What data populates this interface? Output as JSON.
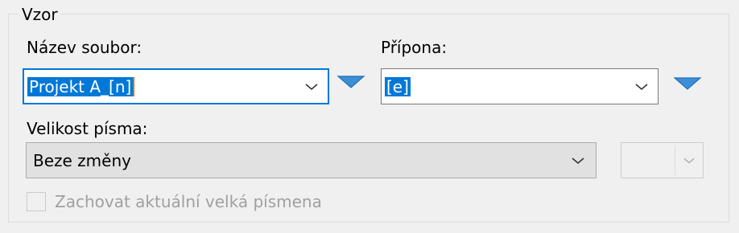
{
  "group": {
    "title": "Vzor"
  },
  "filename": {
    "label": "Název soubor:",
    "value": "Projekt A_[n]"
  },
  "extension": {
    "label": "Přípona:",
    "value": "[e]"
  },
  "font_size": {
    "label": "Velikost písma:",
    "value": "Beze změny",
    "secondary_value": ""
  },
  "keep_case": {
    "label": "Zachovat aktuální velká písmena",
    "checked": false
  },
  "icons": {
    "dropdown_chevron": "chevron-down-icon",
    "insert_menu": "triangle-down-icon"
  },
  "colors": {
    "accent": "#0078d7",
    "menu_arrow": "#3c8fd6",
    "disabled_text": "#a0a0a0"
  }
}
